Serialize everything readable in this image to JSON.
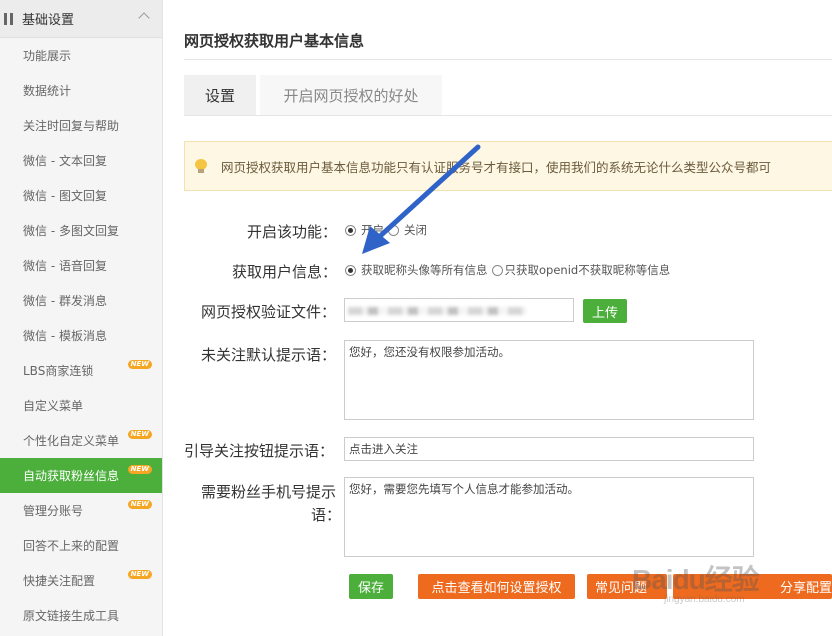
{
  "sidebar": {
    "section_title": "基础设置",
    "items": [
      {
        "label": "功能展示",
        "badge": ""
      },
      {
        "label": "数据统计",
        "badge": ""
      },
      {
        "label": "关注时回复与帮助",
        "badge": ""
      },
      {
        "label": "微信 - 文本回复",
        "badge": ""
      },
      {
        "label": "微信 - 图文回复",
        "badge": ""
      },
      {
        "label": "微信 - 多图文回复",
        "badge": ""
      },
      {
        "label": "微信 - 语音回复",
        "badge": ""
      },
      {
        "label": "微信 - 群发消息",
        "badge": ""
      },
      {
        "label": "微信 - 模板消息",
        "badge": ""
      },
      {
        "label": "LBS商家连锁",
        "badge": "NEW"
      },
      {
        "label": "自定义菜单",
        "badge": ""
      },
      {
        "label": "个性化自定义菜单",
        "badge": "NEW"
      },
      {
        "label": "自动获取粉丝信息",
        "badge": "NEW",
        "active": true
      },
      {
        "label": "管理分账号",
        "badge": "NEW"
      },
      {
        "label": "回答不上来的配置",
        "badge": ""
      },
      {
        "label": "快捷关注配置",
        "badge": "NEW"
      },
      {
        "label": "原文链接生成工具",
        "badge": ""
      }
    ]
  },
  "main": {
    "title": "网页授权获取用户基本信息",
    "tabs": [
      {
        "label": "设置",
        "active": true
      },
      {
        "label": "开启网页授权的好处",
        "active": false
      }
    ],
    "notice": "网页授权获取用户基本信息功能只有认证服务号才有接口，使用我们的系统无论什么类型公众号都可",
    "form": {
      "enable_label": "开启该功能：",
      "enable_on": "开启",
      "enable_off": "关闭",
      "fetch_label": "获取用户信息：",
      "fetch_all": "获取昵称头像等所有信息",
      "fetch_openid": "只获取openid不获取昵称等信息",
      "verify_label": "网页授权验证文件：",
      "upload_button": "上传",
      "unfollow_label": "未关注默认提示语：",
      "unfollow_value": "您好，您还没有权限参加活动。",
      "guide_label": "引导关注按钮提示语：",
      "guide_value": "点击进入关注",
      "phone_label_1": "需要粉丝手机号提示",
      "phone_label_2": "语：",
      "phone_value": "您好，需要您先填写个人信息才能参加活动。"
    },
    "buttons": {
      "save": "保存",
      "howto": "点击查看如何设置授权",
      "faq": "常见问题",
      "share": "分享配置"
    }
  },
  "watermark": {
    "main": "Baidu经验",
    "sub": "jingyan.baidu.com"
  },
  "colors": {
    "accent_green": "#4caf3c",
    "accent_orange": "#ee6a1e",
    "arrow_blue": "#2f63c8",
    "notice_bg": "#fdf7e3"
  }
}
